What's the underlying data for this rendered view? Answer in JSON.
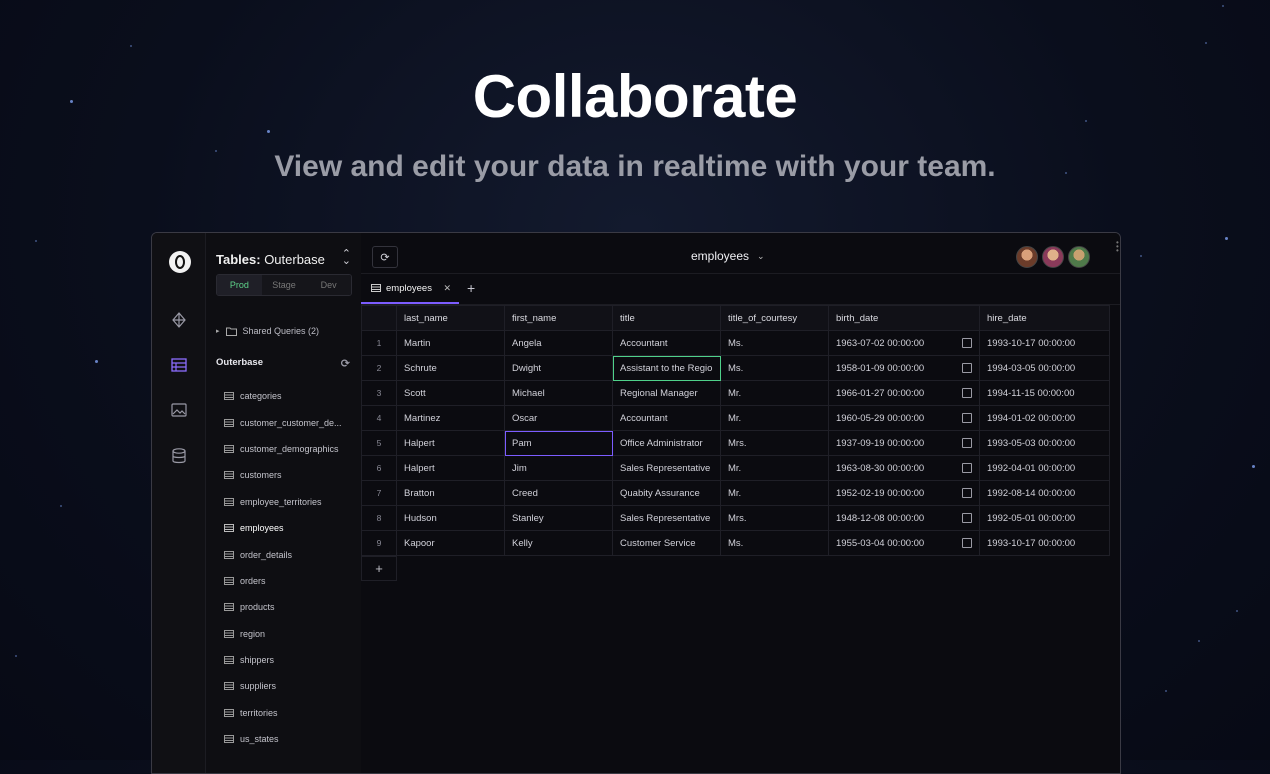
{
  "hero": {
    "title": "Collaborate",
    "subtitle": "View and edit your data in realtime with your team."
  },
  "sidebar": {
    "tables_label": "Tables:",
    "tables_value": "Outerbase",
    "envs": [
      "Prod",
      "Stage",
      "Dev"
    ],
    "active_env": "Prod",
    "shared_queries": "Shared Queries (2)",
    "section": "Outerbase",
    "tables": [
      "categories",
      "customer_customer_de...",
      "customer_demographics",
      "customers",
      "employee_territories",
      "employees",
      "order_details",
      "orders",
      "products",
      "region",
      "shippers",
      "suppliers",
      "territories",
      "us_states"
    ]
  },
  "topbar": {
    "title": "employees"
  },
  "tabs": [
    {
      "label": "employees"
    }
  ],
  "grid": {
    "columns": [
      "last_name",
      "first_name",
      "title",
      "title_of_courtesy",
      "birth_date",
      "hire_date"
    ],
    "rows": [
      {
        "n": "1",
        "last_name": "Martin",
        "first_name": "Angela",
        "title": "Accountant",
        "courtesy": "Ms.",
        "birth_date": "1963-07-02 00:00:00",
        "hire_date": "1993-10-17 00:00:00"
      },
      {
        "n": "2",
        "last_name": "Schrute",
        "first_name": "Dwight",
        "title": "Assistant to the Regio",
        "courtesy": "Ms.",
        "birth_date": "1958-01-09 00:00:00",
        "hire_date": "1994-03-05 00:00:00"
      },
      {
        "n": "3",
        "last_name": "Scott",
        "first_name": "Michael",
        "title": "Regional Manager",
        "courtesy": "Mr.",
        "birth_date": "1966-01-27 00:00:00",
        "hire_date": "1994-11-15 00:00:00"
      },
      {
        "n": "4",
        "last_name": "Martinez",
        "first_name": "Oscar",
        "title": "Accountant",
        "courtesy": "Mr.",
        "birth_date": "1960-05-29 00:00:00",
        "hire_date": "1994-01-02 00:00:00"
      },
      {
        "n": "5",
        "last_name": "Halpert",
        "first_name": "Pam",
        "title": "Office Administrator",
        "courtesy": "Mrs.",
        "birth_date": "1937-09-19 00:00:00",
        "hire_date": "1993-05-03 00:00:00"
      },
      {
        "n": "6",
        "last_name": "Halpert",
        "first_name": "Jim",
        "title": "Sales Representative",
        "courtesy": "Mr.",
        "birth_date": "1963-08-30 00:00:00",
        "hire_date": "1992-04-01 00:00:00"
      },
      {
        "n": "7",
        "last_name": "Bratton",
        "first_name": "Creed",
        "title": "Quabity Assurance",
        "courtesy": "Mr.",
        "birth_date": "1952-02-19 00:00:00",
        "hire_date": "1992-08-14 00:00:00"
      },
      {
        "n": "8",
        "last_name": "Hudson",
        "first_name": "Stanley",
        "title": "Sales Representative",
        "courtesy": "Mrs.",
        "birth_date": "1948-12-08 00:00:00",
        "hire_date": "1992-05-01 00:00:00"
      },
      {
        "n": "9",
        "last_name": "Kapoor",
        "first_name": "Kelly",
        "title": "Customer Service",
        "courtesy": "Ms.",
        "birth_date": "1955-03-04 00:00:00",
        "hire_date": "1993-10-17 00:00:00"
      }
    ]
  },
  "colors": {
    "accent": "#7c5cff",
    "active_env": "#5ed38a",
    "editing_cell_green": "#4fd18a"
  }
}
